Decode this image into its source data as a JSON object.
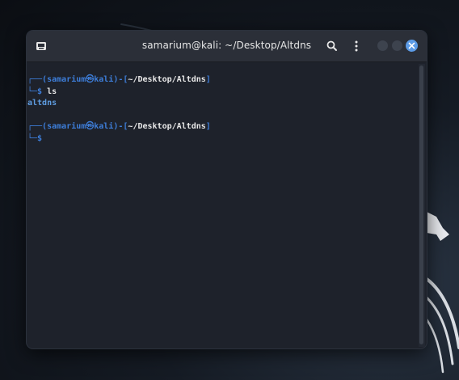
{
  "window": {
    "title": "samarium@kali: ~/Desktop/Altdns",
    "app_icon": "terminal-icon",
    "buttons": {
      "search_icon": "search-icon",
      "menu_icon": "kebab-menu-icon",
      "close_color": "#5c9be6"
    }
  },
  "terminal": {
    "prompt1": {
      "box_top": "┌──(",
      "user": "samarium",
      "at": "㉿",
      "host": "kali",
      "sep": ")-[",
      "path": "~/Desktop/Altdns",
      "close": "]",
      "box_bottom": "└─",
      "dollar": "$",
      "command": " ls"
    },
    "output": [
      "altdns"
    ],
    "prompt2": {
      "box_top": "┌──(",
      "user": "samarium",
      "at": "㉿",
      "host": "kali",
      "sep": ")-[",
      "path": "~/Desktop/Altdns",
      "close": "]",
      "box_bottom": "└─",
      "dollar": "$"
    }
  },
  "colors": {
    "prompt_blue": "#3d7dd8",
    "text_white": "#e8e8e8",
    "output_blue": "#5e9ce0",
    "terminal_bg": "#1e222b",
    "titlebar_bg": "#2b2f38"
  }
}
